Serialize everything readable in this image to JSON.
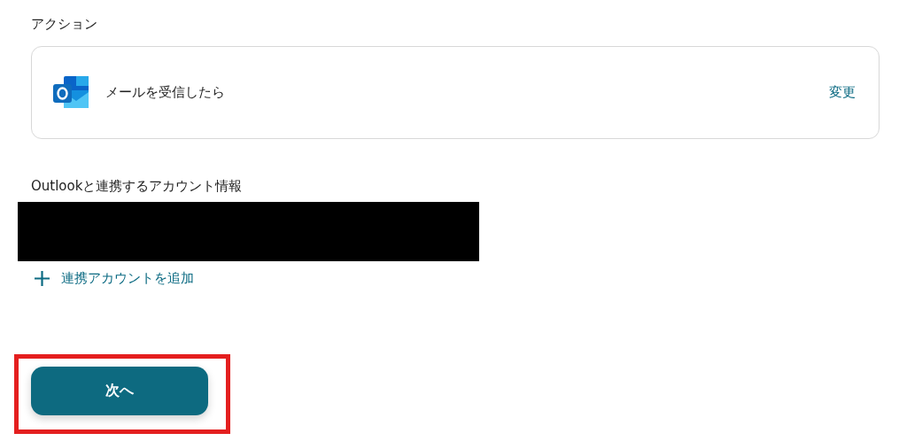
{
  "action_section": {
    "heading": "アクション",
    "trigger": {
      "label": "メールを受信したら",
      "change_link": "変更"
    }
  },
  "account_section": {
    "heading": "Outlookと連携するアカウント情報",
    "add_link": "連携アカウントを追加"
  },
  "next_button": {
    "label": "次へ",
    "highlighted": true
  }
}
